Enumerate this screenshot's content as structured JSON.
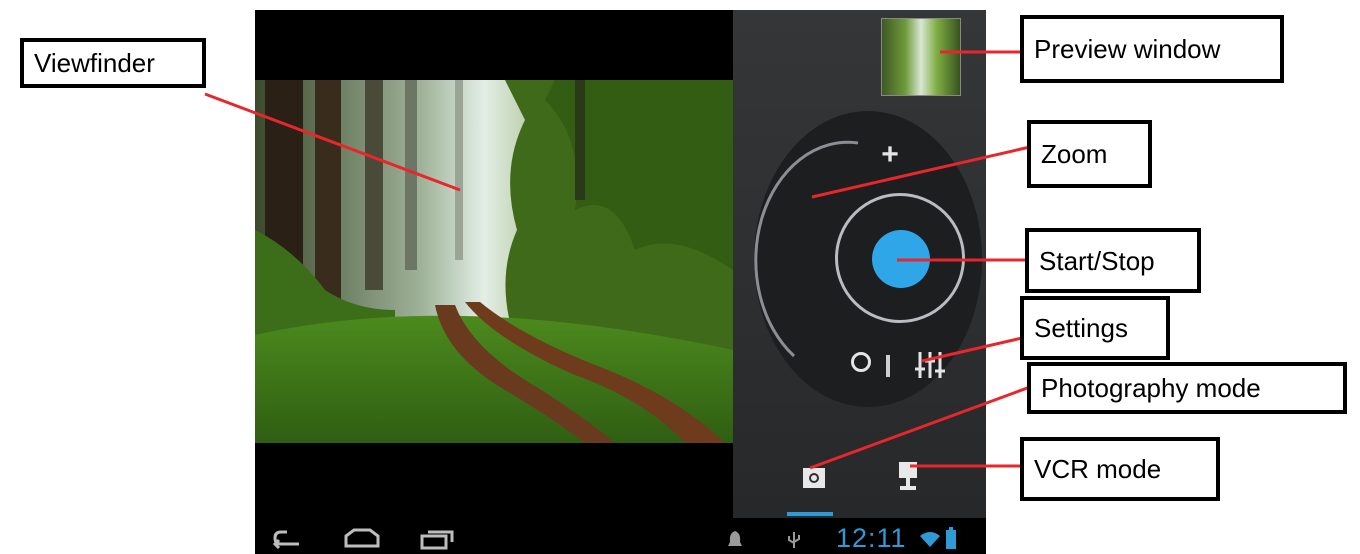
{
  "callouts": {
    "viewfinder": "Viewfinder",
    "preview_window": "Preview window",
    "zoom": "Zoom",
    "start_stop": "Start/Stop",
    "settings": "Settings",
    "photography_mode": "Photography mode",
    "vcr_mode": "VCR mode"
  },
  "dial": {
    "zoom_plus": "+"
  },
  "status_bar": {
    "time": "12:11"
  },
  "icons": {
    "back": "back-arrow-icon",
    "home": "home-icon",
    "recent_apps": "recent-apps-icon",
    "settings": "sliders-icon",
    "camera_mode": "camera-icon",
    "video_mode": "video-camera-icon",
    "status": [
      "notification-icon",
      "usb-icon",
      "wifi-icon",
      "battery-icon"
    ]
  },
  "colors": {
    "shutter": "#2ea6e8",
    "leader_line": "#e8262c",
    "time_text": "#2e9ad6"
  }
}
